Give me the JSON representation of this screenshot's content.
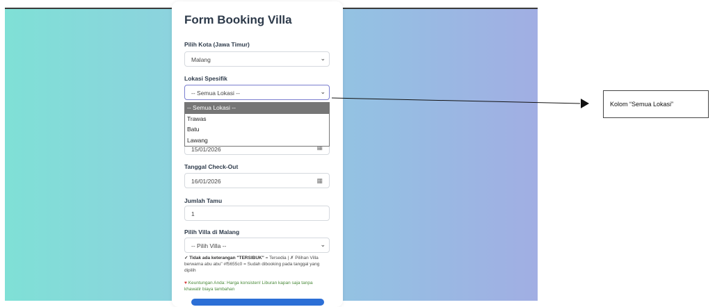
{
  "form": {
    "title": "Form Booking Villa",
    "kota_label": "Pilih Kota (Jawa Timur)",
    "kota_value": "Malang",
    "lokasi_label": "Lokasi Spesifik",
    "lokasi_value": "-- Semua Lokasi --",
    "lokasi_options": [
      "-- Semua Lokasi --",
      "Trawas",
      "Batu",
      "Lawang"
    ],
    "checkin_value": "15/01/2026",
    "checkout_label": "Tanggal Check-Out",
    "checkout_value": "16/01/2026",
    "tamu_label": "Jumlah Tamu",
    "tamu_value": "1",
    "villa_label": "Pilih Villa di Malang",
    "villa_value": "-- Pilih Villa --",
    "note_bold": "✓ Tidak ada keterangan \"TERSIBUK\"",
    "note_rest": " = Tersedia | ✗ Pilihan Villa berwarna abu abu\" #f5655c0 = Sudah dibooking pada tanggal yang dipilih",
    "promo": "Keuntungan Anda: Harga konsisten! Liburan kapan saja tanpa khawatir biaya tambahan"
  },
  "annotation": {
    "callout_text": "Kolom “Semua Lokasi”"
  },
  "colors": {
    "gradient_start": "#7fe0d6",
    "gradient_end": "#a1aee3",
    "selected_option": "#767676",
    "submit_button": "#2c6fd6"
  }
}
